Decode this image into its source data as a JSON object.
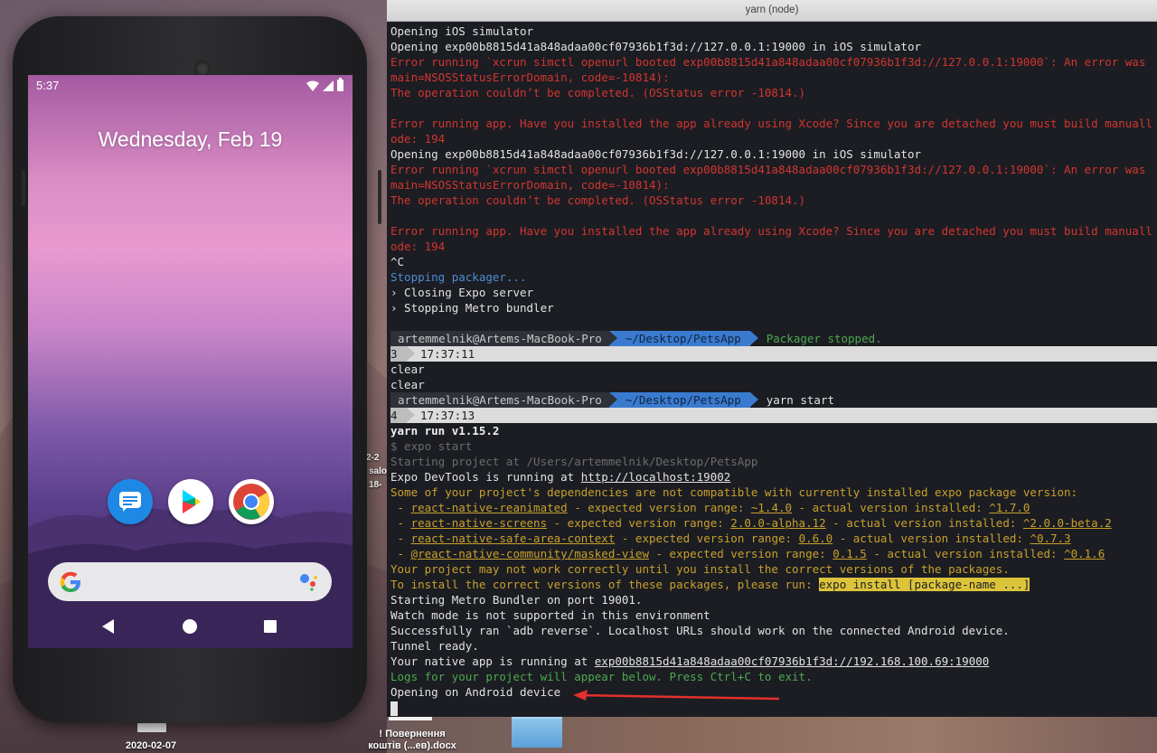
{
  "desktop": {
    "label_left_date": "2020-02-07",
    "label_file_line1": "! Повернення",
    "label_file_line2": "коштів (...ев).docx",
    "peek_1": "2-2",
    "peek_2": "salo",
    "peek_3": "18-"
  },
  "phone": {
    "time": "5:37",
    "date": "Wednesday, Feb 19",
    "apps": [
      "messages-icon",
      "play-store-icon",
      "chrome-icon"
    ]
  },
  "terminal": {
    "title": "yarn (node)",
    "lines_top": [
      {
        "t": "Opening iOS simulator",
        "c": ""
      },
      {
        "t": "Opening exp00b8815d41a848adaa00cf07936b1f3d://127.0.0.1:19000 in iOS simulator",
        "c": ""
      },
      {
        "t": "Error running `xcrun simctl openurl booted exp00b8815d41a848adaa00cf07936b1f3d://127.0.0.1:19000`: An error was",
        "c": "err"
      },
      {
        "t": "main=NSOSStatusErrorDomain, code=-10814):",
        "c": "err"
      },
      {
        "t": "The operation couldn’t be completed. (OSStatus error -10814.)",
        "c": "err"
      },
      {
        "t": "",
        "c": ""
      },
      {
        "t": "Error running app. Have you installed the app already using Xcode? Since you are detached you must build manuall",
        "c": "err"
      },
      {
        "t": "ode: 194",
        "c": "err"
      },
      {
        "t": "Opening exp00b8815d41a848adaa00cf07936b1f3d://127.0.0.1:19000 in iOS simulator",
        "c": ""
      },
      {
        "t": "Error running `xcrun simctl openurl booted exp00b8815d41a848adaa00cf07936b1f3d://127.0.0.1:19000`: An error was",
        "c": "err"
      },
      {
        "t": "main=NSOSStatusErrorDomain, code=-10814):",
        "c": "err"
      },
      {
        "t": "The operation couldn’t be completed. (OSStatus error -10814.)",
        "c": "err"
      },
      {
        "t": "",
        "c": ""
      },
      {
        "t": "Error running app. Have you installed the app already using Xcode? Since you are detached you must build manuall",
        "c": "err"
      },
      {
        "t": "ode: 194",
        "c": "err"
      },
      {
        "t": "^C",
        "c": ""
      },
      {
        "t": "Stopping packager...",
        "c": "blue"
      },
      {
        "t": "› Closing Expo server",
        "c": ""
      },
      {
        "t": "› Stopping Metro bundler",
        "c": ""
      },
      {
        "t": "",
        "c": ""
      }
    ],
    "prompt1": {
      "user": "artemmelnik@Artems-MacBook-Pro",
      "path": "~/Desktop/PetsApp",
      "msg": "Packager stopped.",
      "num": "3",
      "time": "17:37:11"
    },
    "lines_mid": [
      {
        "t": "clear",
        "c": ""
      },
      {
        "t": "clear",
        "c": ""
      }
    ],
    "prompt2": {
      "user": "artemmelnik@Artems-MacBook-Pro",
      "path": "~/Desktop/PetsApp",
      "msg": "yarn start",
      "num": "4",
      "time": "17:37:13"
    },
    "yarn_run": "yarn run v1.15.2",
    "expo_start": "$ expo start",
    "starting_project": "Starting project at /Users/artemmelnik/Desktop/PetsApp",
    "devtools_prefix": "Expo DevTools is running at ",
    "devtools_url": "http://localhost:19002",
    "compat_warning": "Some of your project's dependencies are not compatible with currently installed expo package version:",
    "deps": [
      {
        "name": "react-native-reanimated",
        "expected": "~1.4.0",
        "actual": "^1.7.0"
      },
      {
        "name": "react-native-screens",
        "expected": "2.0.0-alpha.12",
        "actual": "^2.0.0-beta.2"
      },
      {
        "name": "react-native-safe-area-context",
        "expected": "0.6.0",
        "actual": "^0.7.3"
      },
      {
        "name": "@react-native-community/masked-view",
        "expected": "0.1.5",
        "actual": "^0.1.6"
      }
    ],
    "dep_mid1": " - expected version range: ",
    "dep_mid2": " - actual version installed: ",
    "may_not_work": "Your project may not work correctly until you install the correct versions of the packages.",
    "install_prefix": "To install the correct versions of these packages, please run: ",
    "install_cmd": "expo install [package-name ...]",
    "metro": "Starting Metro Bundler on port 19001.",
    "watch_mode": "Watch mode is not supported in this environment",
    "adb": "Successfully ran `adb reverse`. Localhost URLs should work on the connected Android device.",
    "tunnel": "Tunnel ready.",
    "native_prefix": "Your native app is running at ",
    "native_url": "exp00b8815d41a848adaa00cf07936b1f3d://192.168.100.69:19000",
    "logs": "Logs for your project will appear below. Press Ctrl+C to exit.",
    "opening_android": "Opening on Android device"
  },
  "colors": {
    "error": "#d3352f",
    "info_blue": "#4e8cd6",
    "success_green": "#4ea84e",
    "warning_yellow": "#c9a02a",
    "annotation_arrow": "#e3302c"
  }
}
